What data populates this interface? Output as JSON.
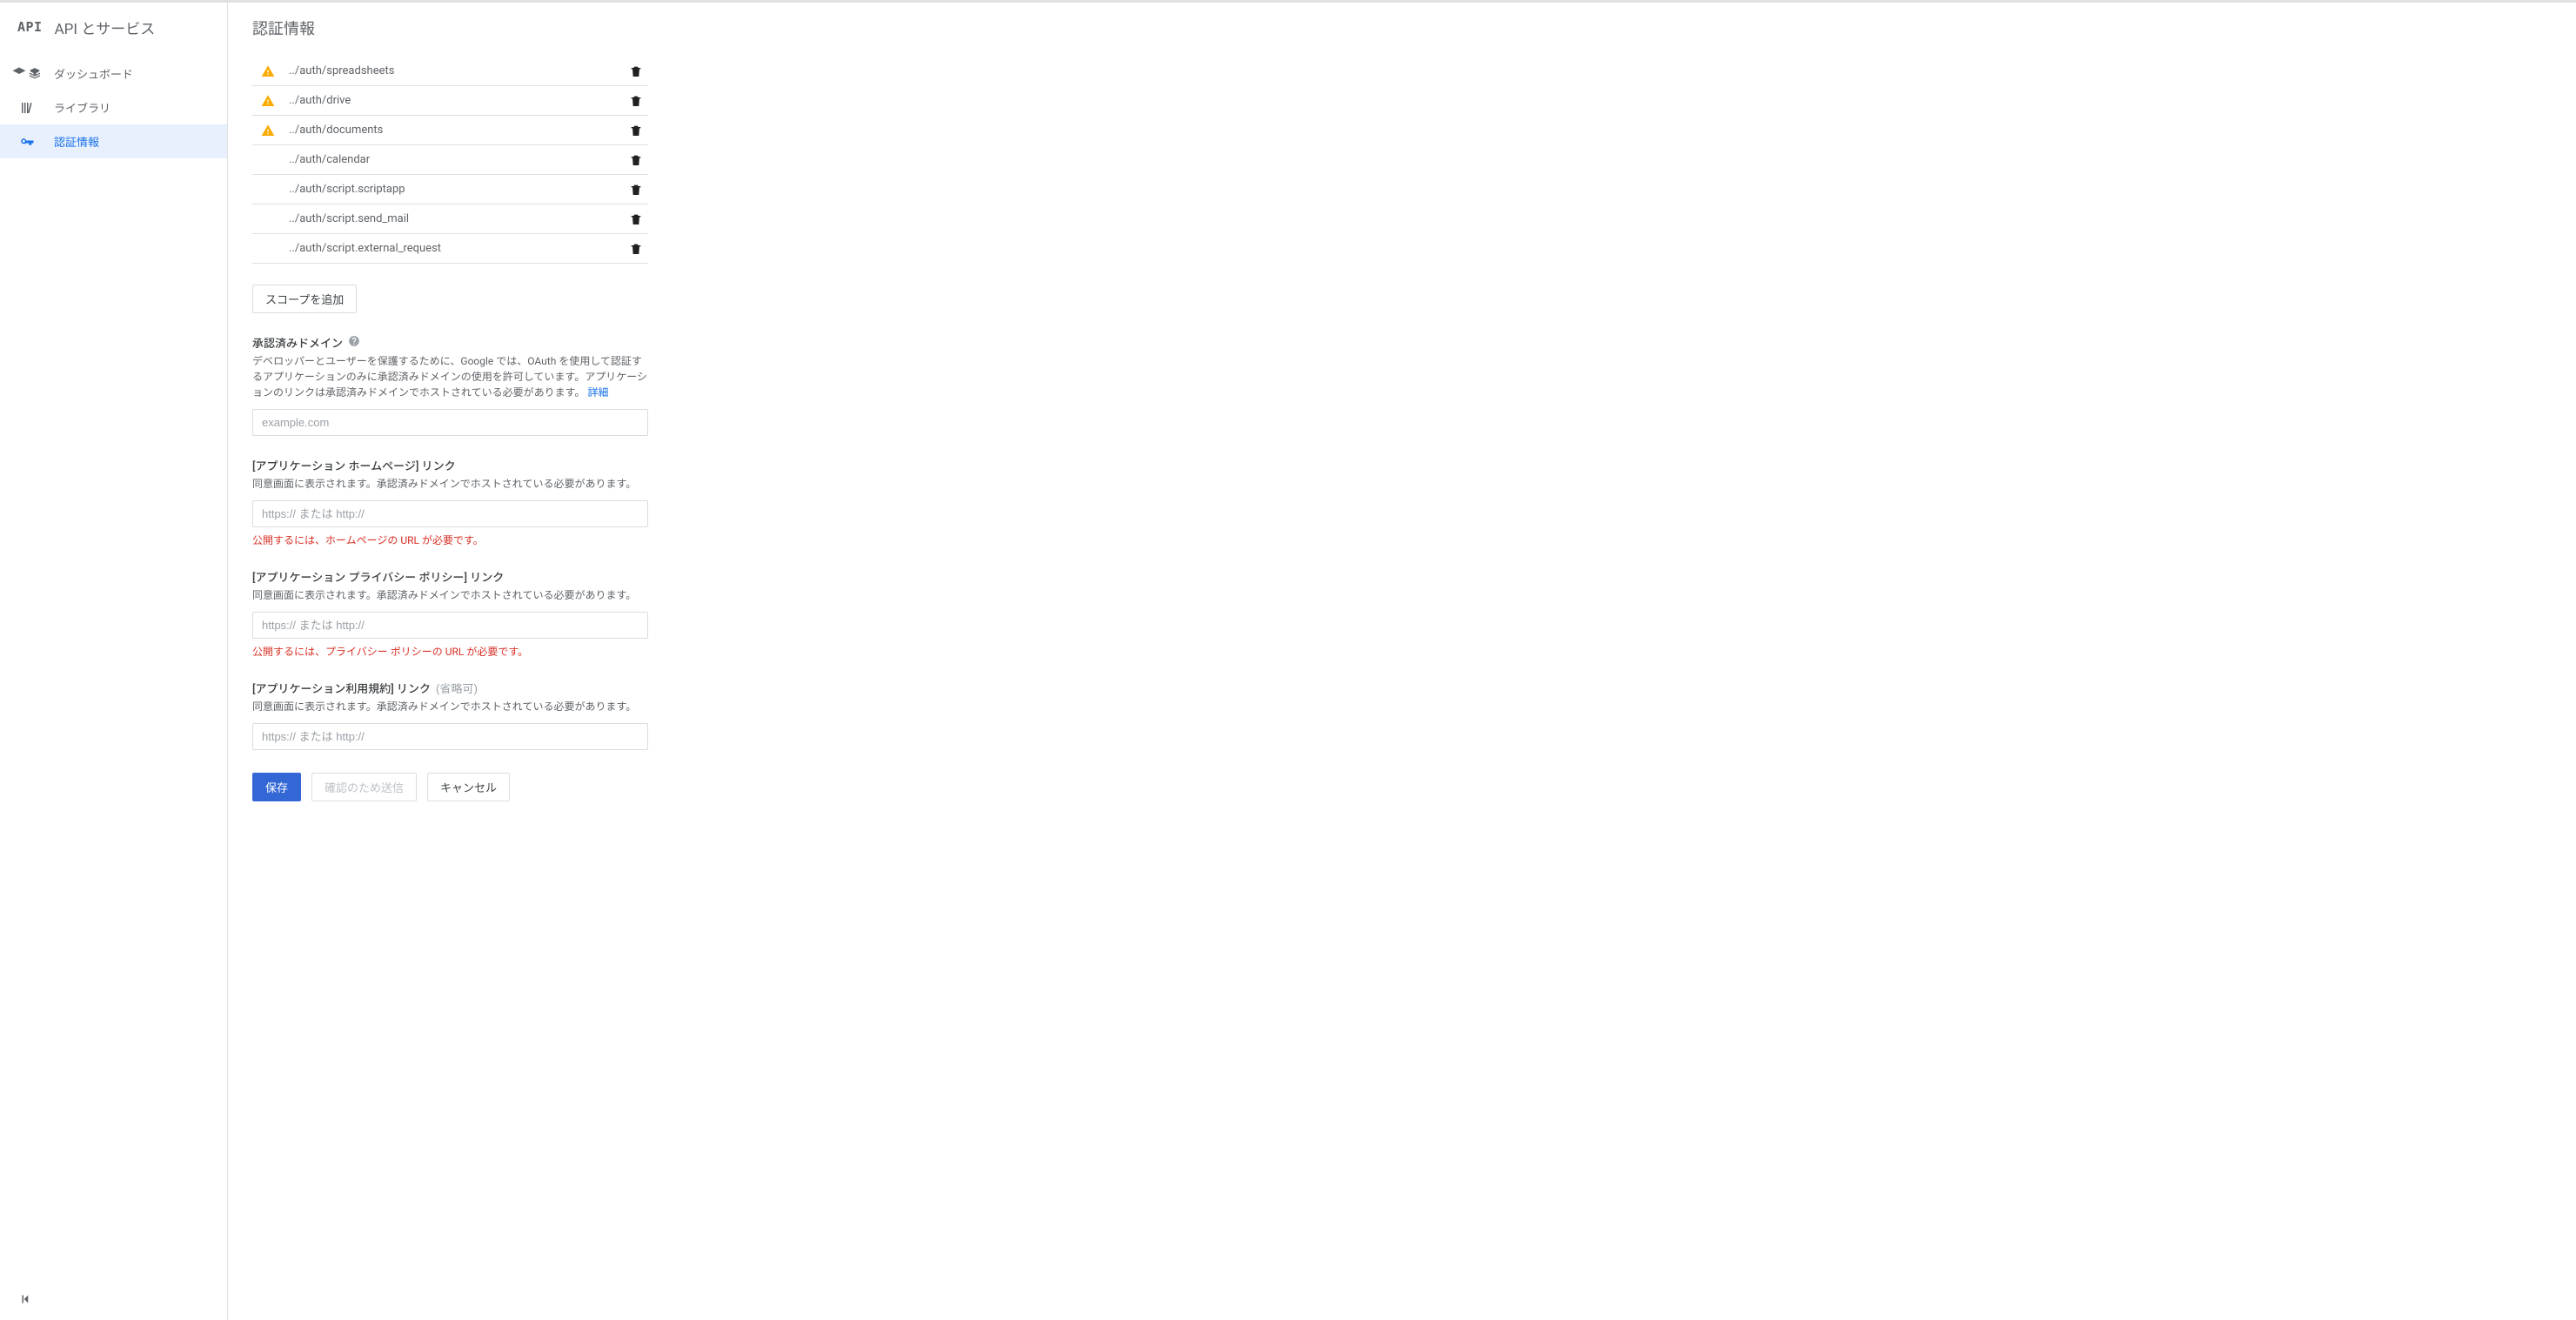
{
  "sidebar": {
    "logo": "API",
    "title": "API とサービス",
    "items": [
      {
        "label": "ダッシュボード",
        "icon": "dashboard",
        "active": false
      },
      {
        "label": "ライブラリ",
        "icon": "library",
        "active": false
      },
      {
        "label": "認証情報",
        "icon": "key",
        "active": true
      }
    ]
  },
  "page": {
    "title": "認証情報"
  },
  "scopes": [
    {
      "path": "../auth/spreadsheets",
      "warn": true
    },
    {
      "path": "../auth/drive",
      "warn": true
    },
    {
      "path": "../auth/documents",
      "warn": true
    },
    {
      "path": "../auth/calendar",
      "warn": false
    },
    {
      "path": "../auth/script.scriptapp",
      "warn": false
    },
    {
      "path": "../auth/script.send_mail",
      "warn": false
    },
    {
      "path": "../auth/script.external_request",
      "warn": false
    }
  ],
  "add_scope_label": "スコープを追加",
  "authorized_domains": {
    "title": "承認済みドメイン",
    "desc": "デベロッパーとユーザーを保護するために、Google では、OAuth を使用して認証するアプリケーションのみに承認済みドメインの使用を許可しています。アプリケーションのリンクは承認済みドメインでホストされている必要があります。",
    "details_link": "詳細",
    "placeholder": "example.com"
  },
  "homepage": {
    "title": "[アプリケーション ホームページ] リンク",
    "desc": "同意画面に表示されます。承認済みドメインでホストされている必要があります。",
    "placeholder": "https:// または http://",
    "error": "公開するには、ホームページの URL が必要です。"
  },
  "privacy": {
    "title": "[アプリケーション プライバシー ポリシー] リンク",
    "desc": "同意画面に表示されます。承認済みドメインでホストされている必要があります。",
    "placeholder": "https:// または http://",
    "error": "公開するには、プライバシー ポリシーの URL が必要です。"
  },
  "tos": {
    "title": "[アプリケーション利用規約] リンク",
    "optional": "(省略可)",
    "desc": "同意画面に表示されます。承認済みドメインでホストされている必要があります。",
    "placeholder": "https:// または http://"
  },
  "buttons": {
    "save": "保存",
    "submit_for_verification": "確認のため送信",
    "cancel": "キャンセル"
  }
}
